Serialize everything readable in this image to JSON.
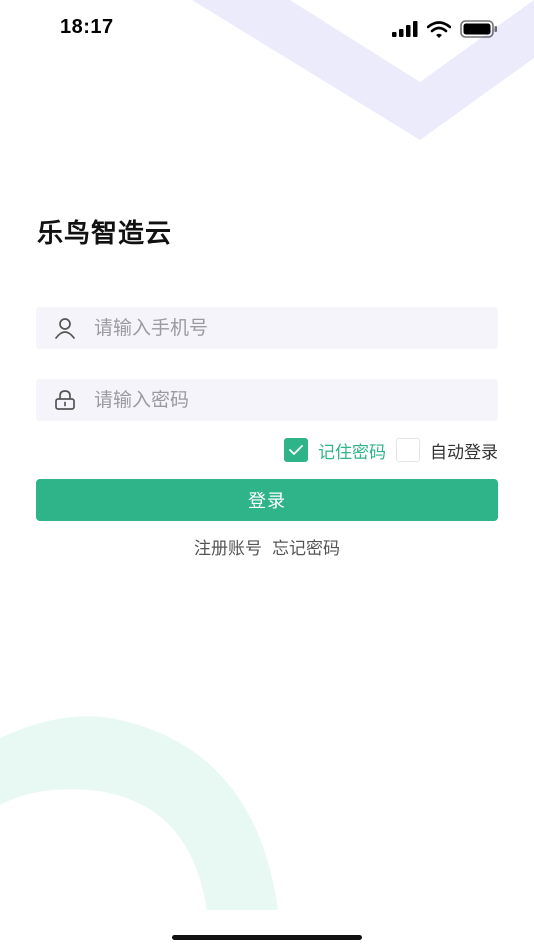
{
  "status_bar": {
    "time": "18:17"
  },
  "app": {
    "title": "乐鸟智造云"
  },
  "form": {
    "phone_placeholder": "请输入手机号",
    "password_placeholder": "请输入密码",
    "remember_password": {
      "label": "记住密码",
      "checked": true
    },
    "auto_login": {
      "label": "自动登录",
      "checked": false
    },
    "login_button": "登录"
  },
  "links": {
    "register": "注册账号",
    "forgot_password": "忘记密码"
  },
  "colors": {
    "accent": "#2fb389",
    "input_bg": "#f4f4fa",
    "deco_top": "#ebebfb",
    "deco_bottom": "#e8f8f3"
  },
  "icons": {
    "phone_field": "user-icon",
    "password_field": "lock-icon",
    "remember_check": "check-icon"
  }
}
